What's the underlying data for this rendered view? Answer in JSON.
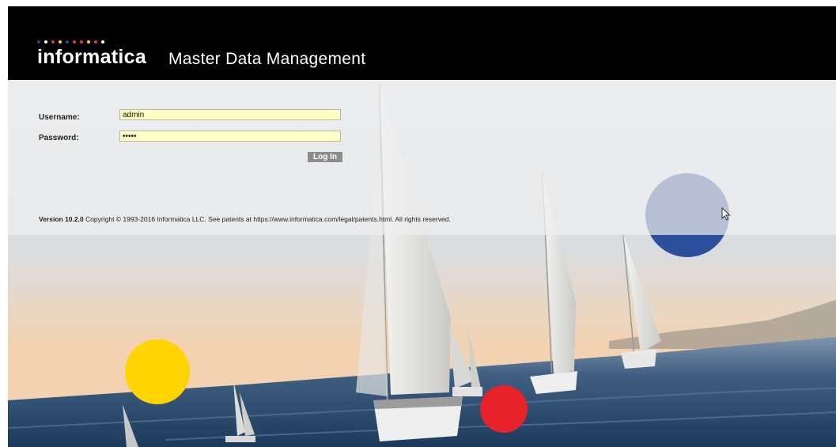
{
  "brand": {
    "name": "informatica",
    "product": "Master Data Management",
    "dot_colors": [
      "#1e4fa0",
      "#ffffff",
      "#e03a3a",
      "#ffd400",
      "#1e4fa0",
      "#e03a3a",
      "#e03a3a",
      "#ffd400",
      "#e03a3a",
      "#ffffff"
    ]
  },
  "login": {
    "username_label": "Username:",
    "username_value": "admin",
    "password_label": "Password:",
    "password_value": "•••••",
    "button_label": "Log In"
  },
  "footer": {
    "version": "Version 10.2.0",
    "copyright": " Copyright © 1993-2016 Informatica LLC. See patents at https://www.informatica.com/legal/patents.html. All rights reserved."
  },
  "decorations": {
    "yellow": "#ffd400",
    "red": "#e8222b",
    "blue": "#2c4f9b",
    "blue_light": "#b6bfd3"
  },
  "icons": {
    "cursor": "mouse-pointer-icon"
  }
}
